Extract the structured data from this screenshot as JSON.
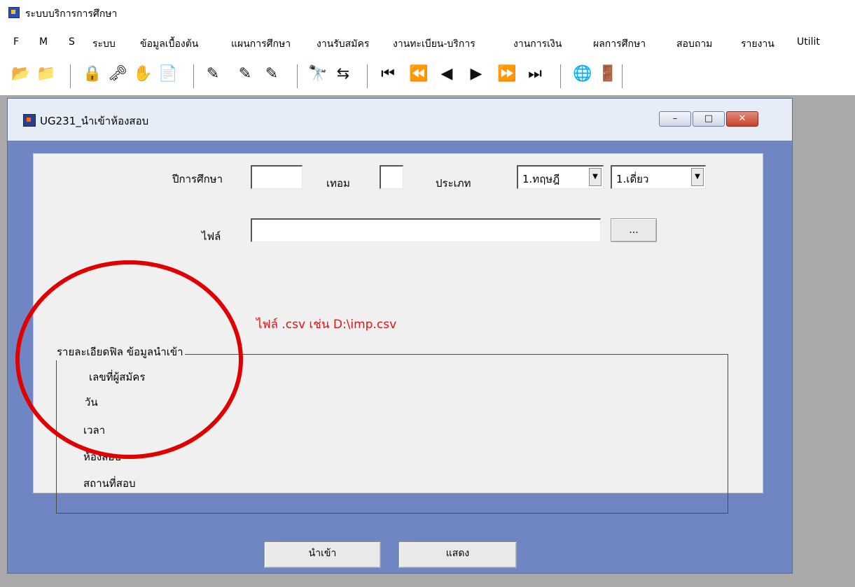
{
  "app": {
    "title": "ระบบบริการการศึกษา"
  },
  "menu": {
    "items": [
      {
        "label": "F"
      },
      {
        "label": "M"
      },
      {
        "label": "S"
      },
      {
        "label": "ระบบ"
      },
      {
        "label": "ข้อมูลเบื้องต้น"
      },
      {
        "label": "แผนการศึกษา"
      },
      {
        "label": "งานรับสมัคร"
      },
      {
        "label": "งานทะเบียน-บริการ"
      },
      {
        "label": "งานการเงิน"
      },
      {
        "label": "ผลการศึกษา"
      },
      {
        "label": "สอบถาม"
      },
      {
        "label": "รายงาน"
      },
      {
        "label": "Utilit"
      }
    ]
  },
  "toolbar": {
    "icons": [
      "open-folder-icon",
      "export-folder-icon",
      "lock-icon",
      "key-icon",
      "hand-icon",
      "document-icon",
      "pencil-icon",
      "pencil-add-icon",
      "pencil-edit-icon",
      "binoculars-icon",
      "replace-icon",
      "first-record-icon",
      "prev-page-icon",
      "prev-record-icon",
      "next-record-icon",
      "next-page-icon",
      "last-record-icon",
      "globe-icon",
      "exit-door-icon"
    ]
  },
  "window": {
    "title": "UG231_นำเข้าห้องสอบ",
    "controls": {
      "minimize": "–",
      "maximize": "□",
      "close": "✕"
    }
  },
  "form": {
    "year_label": "ปีการศึกษา",
    "year_value": "",
    "term_label": "เทอม",
    "term_value": "",
    "type_label": "ประเภท",
    "type_select_value": "1.ทฤษฎี",
    "type2_select_value": "1.เดี่ยว",
    "file_label": "ไฟล์",
    "file_value": "",
    "browse_label": "...",
    "hint": "ไฟล์ .csv เช่น D:\\imp.csv",
    "group_title": "รายละเอียดฟิล ข้อมูลนำเข้า",
    "fields": [
      "เลขที่ผู้สมัคร",
      "วัน",
      "เวลา",
      "ห้องสอบ",
      "สถานที่สอบ"
    ]
  },
  "actions": {
    "import_label": "นำเข้า",
    "show_label": "แสดง"
  },
  "colors": {
    "blue_frame": "#6f86c2",
    "mdi_background": "#a9a9a9",
    "hint_red": "#e01414",
    "annotation_red": "#e10000"
  }
}
